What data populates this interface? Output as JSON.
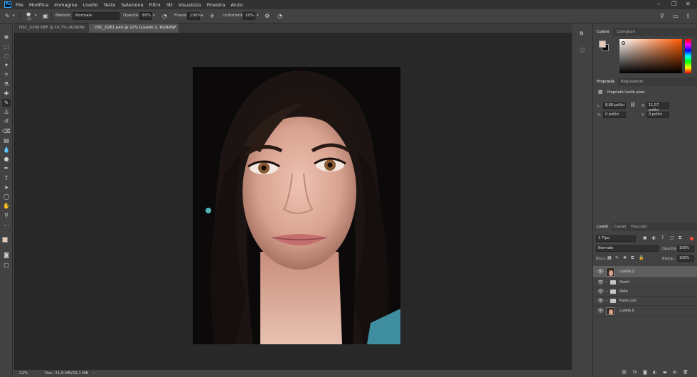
{
  "menubar": {
    "items": [
      "File",
      "Modifica",
      "Immagine",
      "Livello",
      "Testo",
      "Selezione",
      "Filtro",
      "3D",
      "Visualizza",
      "Finestra",
      "Aiuto"
    ],
    "logo": "Ps"
  },
  "options": {
    "brush_size": "11",
    "metodo_label": "Metodo:",
    "metodo_value": "Normale",
    "opacita_label": "Opacità:",
    "opacita_value": "80%",
    "flusso_label": "Flusso:",
    "flusso_value": "100%",
    "uniformita_label": "Uniformità:",
    "uniformita_value": "10%"
  },
  "tabs": [
    {
      "label": "DSC_0266.NEF @ 16,7% (RGB/8)",
      "active": false
    },
    {
      "label": "DSC_0261.psd @ 22% (Livello 2, RGB/8) *",
      "active": true
    }
  ],
  "status": {
    "zoom": "22%",
    "doc": "Doc: 21,9 MB/33,1 MB"
  },
  "color_panel": {
    "tabs": [
      "Colore",
      "Campioni"
    ],
    "colors": {
      "foreground": "#e6c8b5",
      "hue": "#ff5a00"
    }
  },
  "properties": {
    "tabs": [
      "Proprietà",
      "Regolazioni"
    ],
    "title": "Proprietà livello pixel",
    "w_label": "L:",
    "w_value": "8,68 pollici",
    "h_label": "A:",
    "h_value": "11,57 pollici",
    "x_label": "X:",
    "x_value": "0 pollici",
    "y_label": "Y:",
    "y_value": "0 pollici"
  },
  "layers_panel": {
    "tabs": [
      "Livelli",
      "Canali",
      "Tracciati"
    ],
    "filter_label": "Tipo",
    "blend_mode": "Normale",
    "opacity_label": "Opacità:",
    "opacity_value": "100%",
    "lock_label": "Blocc.:",
    "fill_label": "Riemp.:",
    "fill_value": "100%",
    "layers": [
      {
        "name": "Livello 2",
        "type": "pixel",
        "selected": true
      },
      {
        "name": "Occhi",
        "type": "group",
        "selected": false
      },
      {
        "name": "Pelle",
        "type": "group",
        "selected": false
      },
      {
        "name": "Punti corr",
        "type": "group",
        "selected": false
      },
      {
        "name": "Livello 0",
        "type": "pixel",
        "selected": false
      }
    ]
  }
}
